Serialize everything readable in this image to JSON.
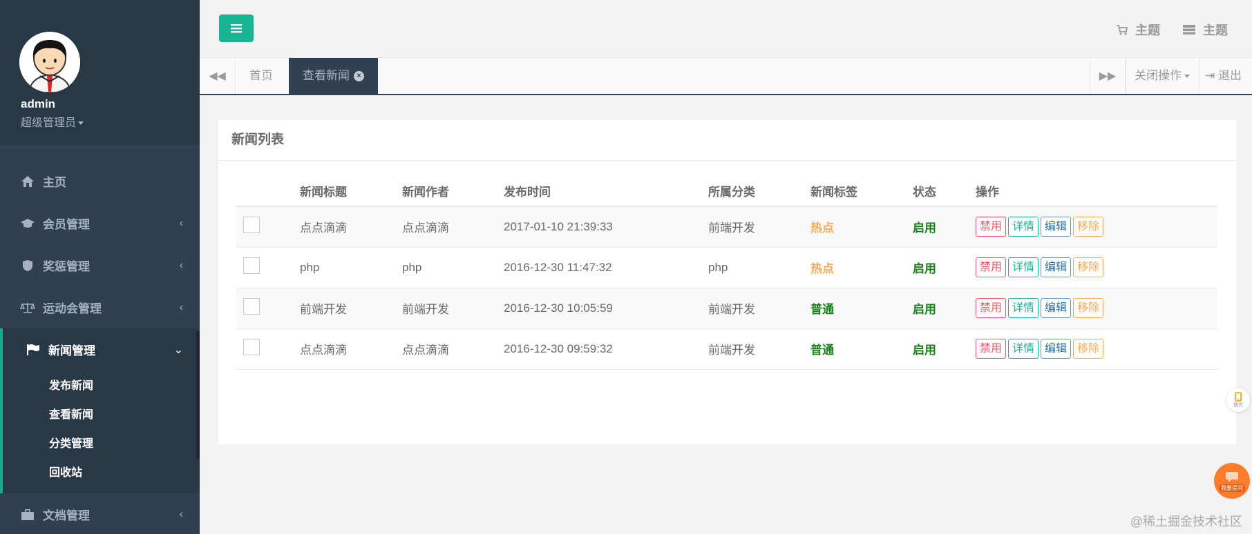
{
  "colors": {
    "sidebar_bg": "#2f4050",
    "accent_green": "#1ab394",
    "danger": "#ed5565",
    "warning": "#f8ac59",
    "info": "#5b9ad5"
  },
  "sidebar": {
    "username": "admin",
    "role": "超级管理员",
    "items": [
      {
        "label": "主页",
        "icon": "home-icon",
        "has_chevron": false
      },
      {
        "label": "会员管理",
        "icon": "graduation-cap-icon",
        "has_chevron": true
      },
      {
        "label": "奖惩管理",
        "icon": "shield-icon",
        "has_chevron": true
      },
      {
        "label": "运动会管理",
        "icon": "balance-scale-icon",
        "has_chevron": true
      },
      {
        "label": "新闻管理",
        "icon": "flag-icon",
        "has_chevron": true,
        "expanded": true
      },
      {
        "label": "文档管理",
        "icon": "briefcase-icon",
        "has_chevron": true
      }
    ],
    "submenu": [
      "发布新闻",
      "查看新闻",
      "分类管理",
      "回收站"
    ]
  },
  "topbar": {
    "theme_link_1": "主题",
    "theme_link_2": "主题"
  },
  "tabs": {
    "home": "首页",
    "active": "查看新闻",
    "close_ops": "关闭操作",
    "logout": "退出"
  },
  "panel": {
    "title": "新闻列表",
    "headers": [
      "新闻标题",
      "新闻作者",
      "发布时间",
      "所属分类",
      "新闻标签",
      "状态",
      "操作"
    ],
    "rows": [
      {
        "title": "点点滴滴",
        "author": "点点滴滴",
        "time": "2017-01-10 21:39:33",
        "category": "前端开发",
        "tag": "热点",
        "tag_type": "hot",
        "status": "启用"
      },
      {
        "title": "php",
        "author": "php",
        "time": "2016-12-30 11:47:32",
        "category": "php",
        "tag": "热点",
        "tag_type": "hot",
        "status": "启用"
      },
      {
        "title": "前端开发",
        "author": "前端开发",
        "time": "2016-12-30 10:05:59",
        "category": "前端开发",
        "tag": "普通",
        "tag_type": "normal",
        "status": "启用"
      },
      {
        "title": "点点滴滴",
        "author": "点点滴滴",
        "time": "2016-12-30 09:59:32",
        "category": "前端开发",
        "tag": "普通",
        "tag_type": "normal",
        "status": "启用"
      }
    ],
    "actions": {
      "ban": "禁用",
      "detail": "详情",
      "edit": "编辑",
      "remove": "移除"
    }
  },
  "floating": {
    "mobile_label": "微信",
    "ask_label": "我要提问"
  },
  "watermark": "@稀土掘金技术社区"
}
